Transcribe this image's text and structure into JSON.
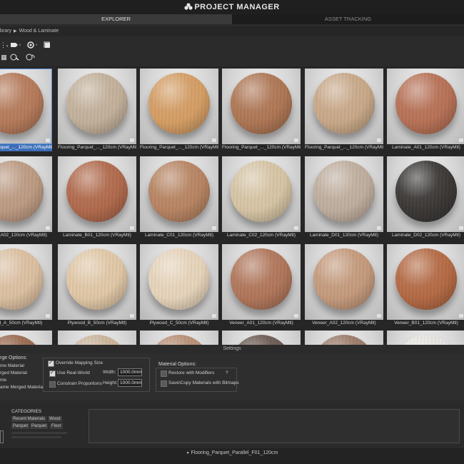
{
  "app": {
    "title": "PROJECT MANAGER"
  },
  "tabs": [
    {
      "label": "EXPLORER",
      "active": true
    },
    {
      "label": "ASSET TRACKING",
      "active": false
    }
  ],
  "breadcrumb": {
    "items": [
      "brary",
      "Wood & Laminate"
    ]
  },
  "toolbar": {
    "row1": [
      "view-mode-icon",
      "tag-icon",
      "render-icon",
      "square-icon"
    ],
    "row2": [
      "grid-icon",
      "sphere-settings-icon",
      "sphere-refresh-icon"
    ]
  },
  "materials": [
    {
      "label": "Flooring_Parquet_..._120cm (VRayMtl)",
      "color": "#b57a5a",
      "selected": true
    },
    {
      "label": "Flooring_Parquet_..._120cm (VRayMtl)",
      "color": "#c2b09a",
      "selected": false
    },
    {
      "label": "Flooring_Parquet_..._120cm (VRayMtl)",
      "color": "#d49d64",
      "selected": false
    },
    {
      "label": "Flooring_Parquet_..._120cm (VRayMtl)",
      "color": "#ae7654",
      "selected": false
    },
    {
      "label": "Flooring_Parquet_..._120cm (VRayMtl)",
      "color": "#c8a888",
      "selected": false
    },
    {
      "label": "Laminate_A01_120cm (VRayMtl)",
      "color": "#b77156",
      "selected": false
    },
    {
      "label": "Laminate_A02_120cm (VRayMtl)",
      "color": "#bc9a82",
      "selected": false
    },
    {
      "label": "Laminate_B01_120cm (VRayMtl)",
      "color": "#b06a4c",
      "selected": false
    },
    {
      "label": "Laminate_C01_120cm (VRayMtl)",
      "color": "#b78462",
      "selected": false
    },
    {
      "label": "Laminate_C02_120cm (VRayMtl)",
      "color": "#d6c4a4",
      "selected": false
    },
    {
      "label": "Laminate_D01_120cm (VRayMtl)",
      "color": "#bfae9e",
      "selected": false
    },
    {
      "label": "Laminate_D02_120cm (VRayMtl)",
      "color": "#3b3836",
      "selected": false
    },
    {
      "label": "Plywood_A_50cm (VRayMtl)",
      "color": "#dbbfa0",
      "selected": false
    },
    {
      "label": "Plywood_B_50cm (VRayMtl)",
      "color": "#e0c7a6",
      "selected": false
    },
    {
      "label": "Plywood_C_50cm (VRayMtl)",
      "color": "#e6d3ba",
      "selected": false
    },
    {
      "label": "Veneer_A01_120cm (VRayMtl)",
      "color": "#b0765a",
      "selected": false
    },
    {
      "label": "Veneer_A02_120cm (VRayMtl)",
      "color": "#c49a7c",
      "selected": false
    },
    {
      "label": "Veneer_B01_120cm (VRayMtl)",
      "color": "#b46a44",
      "selected": false
    },
    {
      "label": "",
      "color": "#9a6a50",
      "selected": false
    },
    {
      "label": "",
      "color": "#c9b39a",
      "selected": false
    },
    {
      "label": "",
      "color": "#b78e74",
      "selected": false
    },
    {
      "label": "",
      "color": "#6a5a52",
      "selected": false
    },
    {
      "label": "",
      "color": "#9a7a68",
      "selected": false
    },
    {
      "label": "",
      "color": "#e6e4e0",
      "selected": false
    }
  ],
  "settings_label": "Settings",
  "merge": {
    "title": "rge Options:",
    "options": [
      "me Material",
      "rged Material",
      "me",
      "ame Merged Material"
    ]
  },
  "mapping": {
    "override_label": "Override Mapping Size",
    "override_checked": true,
    "realworld_label": "Use Real-World",
    "realworld_checked": true,
    "constrain_label": "Constrain Proportions",
    "constrain_checked": false,
    "width_label": "Width:",
    "width_value": "1000.0mm",
    "height_label": "Height:",
    "height_value": "1000.0mm"
  },
  "material_options": {
    "title": "Material Options:",
    "restore_label": "Restore with Modifiers",
    "help_label": "?",
    "save_label": "Save\\Copy Materials with Bitmaps"
  },
  "categories": {
    "title": "CATEGORIES",
    "chips": [
      "Recent Materials",
      "Wood",
      "Parquet",
      "Parquet",
      "Floor"
    ]
  },
  "status": {
    "current": "Flooring_Parquet_Parallel_F01_120cm"
  }
}
